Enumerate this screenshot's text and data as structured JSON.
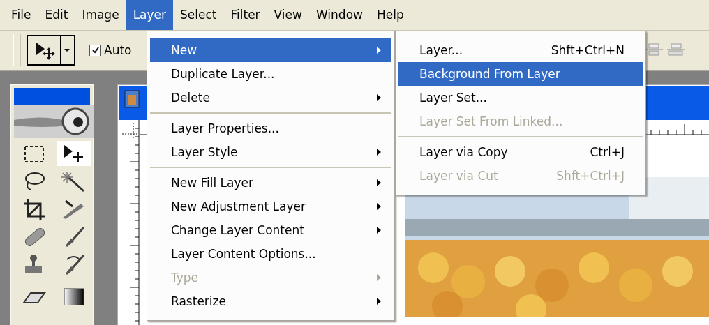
{
  "menubar": {
    "items": [
      {
        "label": "File",
        "selected": false
      },
      {
        "label": "Edit",
        "selected": false
      },
      {
        "label": "Image",
        "selected": false
      },
      {
        "label": "Layer",
        "selected": true
      },
      {
        "label": "Select",
        "selected": false
      },
      {
        "label": "Filter",
        "selected": false
      },
      {
        "label": "View",
        "selected": false
      },
      {
        "label": "Window",
        "selected": false
      },
      {
        "label": "Help",
        "selected": false
      }
    ]
  },
  "options_bar": {
    "auto_select": {
      "label": "Auto",
      "checked": true
    }
  },
  "layer_menu": {
    "items": [
      {
        "kind": "item",
        "label": "New",
        "selected": true,
        "disabled": false,
        "submenu": true
      },
      {
        "kind": "item",
        "label": "Duplicate Layer...",
        "selected": false,
        "disabled": false,
        "submenu": false
      },
      {
        "kind": "item",
        "label": "Delete",
        "selected": false,
        "disabled": false,
        "submenu": true
      },
      {
        "kind": "separator"
      },
      {
        "kind": "item",
        "label": "Layer Properties...",
        "selected": false,
        "disabled": false,
        "submenu": false
      },
      {
        "kind": "item",
        "label": "Layer Style",
        "selected": false,
        "disabled": false,
        "submenu": true
      },
      {
        "kind": "separator"
      },
      {
        "kind": "item",
        "label": "New Fill Layer",
        "selected": false,
        "disabled": false,
        "submenu": true
      },
      {
        "kind": "item",
        "label": "New Adjustment Layer",
        "selected": false,
        "disabled": false,
        "submenu": true
      },
      {
        "kind": "item",
        "label": "Change Layer Content",
        "selected": false,
        "disabled": false,
        "submenu": true
      },
      {
        "kind": "item",
        "label": "Layer Content Options...",
        "selected": false,
        "disabled": false,
        "submenu": false
      },
      {
        "kind": "item",
        "label": "Type",
        "selected": false,
        "disabled": true,
        "submenu": true
      },
      {
        "kind": "item",
        "label": "Rasterize",
        "selected": false,
        "disabled": false,
        "submenu": true
      }
    ]
  },
  "new_submenu": {
    "items": [
      {
        "kind": "item",
        "label": "Layer...",
        "shortcut": "Shft+Ctrl+N",
        "selected": false,
        "disabled": false
      },
      {
        "kind": "item",
        "label": "Background From Layer",
        "selected": true,
        "disabled": false
      },
      {
        "kind": "item",
        "label": "Layer Set...",
        "selected": false,
        "disabled": false
      },
      {
        "kind": "item",
        "label": "Layer Set From Linked...",
        "selected": false,
        "disabled": true
      },
      {
        "kind": "separator"
      },
      {
        "kind": "item",
        "label": "Layer via Copy",
        "shortcut": "Ctrl+J",
        "selected": false,
        "disabled": false
      },
      {
        "kind": "item",
        "label": "Layer via Cut",
        "shortcut": "Shft+Ctrl+J",
        "selected": false,
        "disabled": true
      }
    ]
  }
}
